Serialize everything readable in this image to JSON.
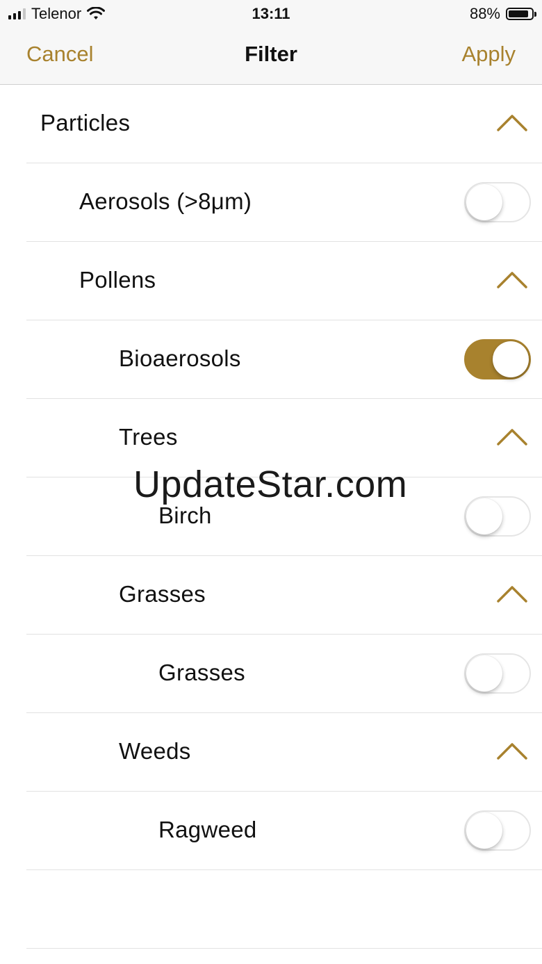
{
  "status_bar": {
    "carrier": "Telenor",
    "time": "13:11",
    "battery_percent": "88%",
    "battery_level": 0.88,
    "signal_bars": 3,
    "signal_bars_total": 4,
    "icons": [
      "signal-icon",
      "wifi-icon",
      "battery-icon"
    ]
  },
  "nav": {
    "cancel_label": "Cancel",
    "title": "Filter",
    "apply_label": "Apply"
  },
  "colors": {
    "accent": "#a8822e",
    "separator": "#e2e2e2",
    "toggle_off_border": "#e5e5e5"
  },
  "rows": [
    {
      "label": "Particles",
      "level": 0,
      "control": "chevron-up-icon"
    },
    {
      "label": "Aerosols (>8μm)",
      "level": 1,
      "control": "toggle",
      "on": false
    },
    {
      "label": "Pollens",
      "level": 1,
      "control": "chevron-up-icon"
    },
    {
      "label": "Bioaerosols",
      "level": 2,
      "control": "toggle",
      "on": true
    },
    {
      "label": "Trees",
      "level": 2,
      "control": "chevron-up-icon"
    },
    {
      "label": "Birch",
      "level": 3,
      "control": "toggle",
      "on": false
    },
    {
      "label": "Grasses",
      "level": 2,
      "control": "chevron-up-icon"
    },
    {
      "label": "Grasses",
      "level": 3,
      "control": "toggle",
      "on": false
    },
    {
      "label": "Weeds",
      "level": 2,
      "control": "chevron-up-icon"
    },
    {
      "label": "Ragweed",
      "level": 3,
      "control": "toggle",
      "on": false
    }
  ],
  "watermark": "UpdateStar.com"
}
